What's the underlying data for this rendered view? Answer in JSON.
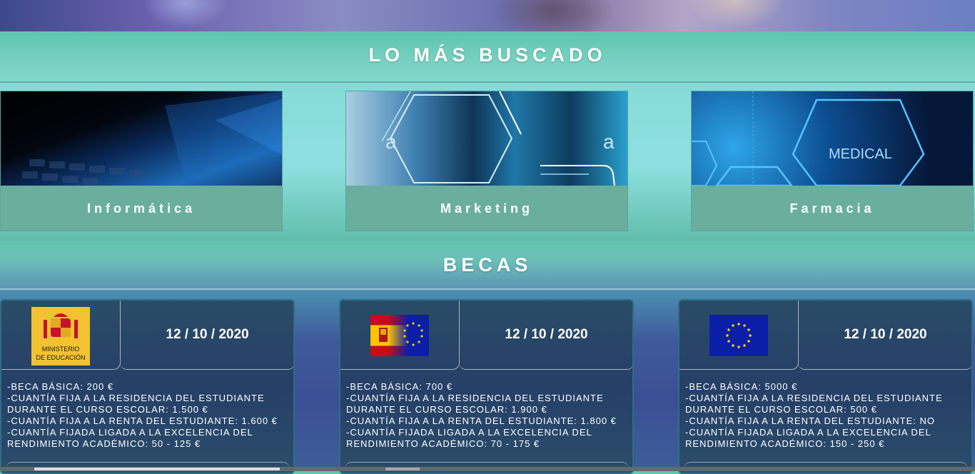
{
  "sections": {
    "most_searched_title": "LO MÁS BUSCADO",
    "scholarships_title": "BECAS"
  },
  "courses": [
    {
      "label": "Informática"
    },
    {
      "label": "Marketing",
      "image_text": "a"
    },
    {
      "label": "Farmacia",
      "image_text": "MEDICAL"
    }
  ],
  "becas": [
    {
      "logo_text_1": "MINISTERIO",
      "logo_text_2": "DE EDUCACIÓN",
      "date": "12 / 10 / 2020",
      "lines": [
        "-BECA BÁSICA: 200 €",
        "-CUANTÍA FIJA A LA RESIDENCIA DEL ESTUDIANTE",
        "DURANTE EL CURSO ESCOLAR: 1.500 €",
        "-CUANTÍA FIJA A LA RENTA DEL ESTUDIANTE: 1.600 €",
        "-CUANTÍA FIJADA LIGADA A LA EXCELENCIA DEL",
        "RENDIMIENTO ACADÉMICO: 50 - 125 €"
      ]
    },
    {
      "date": "12 / 10 / 2020",
      "lines": [
        "-BECA BÁSICA: 700 €",
        "-CUANTÍA FIJA A LA RESIDENCIA DEL ESTUDIANTE",
        "DURANTE EL CURSO ESCOLAR: 1.900 €",
        "-CUANTÍA FIJA A LA RENTA DEL ESTUDIANTE: 1.800 €",
        "-CUANTÍA FIJADA LIGADA A LA EXCELENCIA DEL",
        "RENDIMIENTO ACADÉMICO: 70 - 175 €"
      ]
    },
    {
      "date": "12 / 10 / 2020",
      "lines": [
        "-BECA BÁSICA: 5000 €",
        "-CUANTÍA FIJA A LA RESIDENCIA DEL ESTUDIANTE",
        "DURANTE EL CURSO ESCOLAR: 500 €",
        "-CUANTÍA FIJA A LA RENTA DEL ESTUDIANTE: NO",
        "-CUANTÍA FIJADA LIGADA A LA EXCELENCIA DEL",
        "RENDIMIENTO ACADÉMICO: 150 - 250 €"
      ]
    }
  ],
  "colors": {
    "title_bar": "#63c4ad",
    "caption_bg": "#6aae9d",
    "beca_card_bg": "#263f68",
    "ministerio_yellow": "#f2c230",
    "eu_blue": "#0a1ea8",
    "eu_star": "#ffcc00"
  }
}
